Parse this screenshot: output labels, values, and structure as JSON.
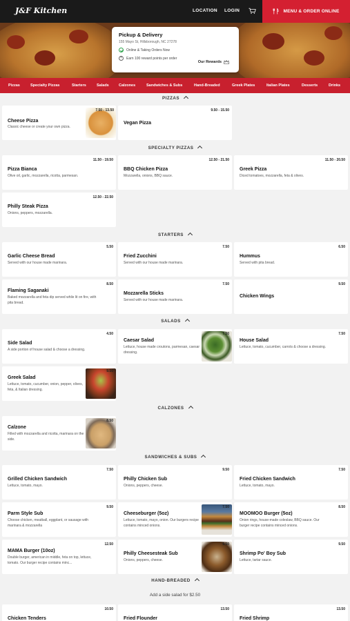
{
  "header": {
    "logo": "J&F Kitchen",
    "location_label": "LOCATION",
    "login_label": "LOGIN",
    "order_label": "MENU & ORDER ONLINE",
    "cart_icon": "cart-icon",
    "order_icon": "fork-knife-icon",
    "accent_color": "#d42031"
  },
  "pickup": {
    "title": "Pickup & Delivery",
    "address": "155 Mayo St, Hillsborough, NC 27278",
    "status": "Online & Taking Orders Now",
    "reward": "Earn 100 reward points per order",
    "rewards_link": "Our Rewards"
  },
  "categories": [
    "Pizzas",
    "Specialty Pizzas",
    "Starters",
    "Salads",
    "Calzones",
    "Sandwiches & Subs",
    "Hand-Breaded",
    "Greek Plates",
    "Italian Plates",
    "Desserts",
    "Drinks"
  ],
  "sections": {
    "pizzas": "PIZZAS",
    "specialty": "SPECIALTY PIZZAS",
    "starters": "STARTERS",
    "salads": "SALADS",
    "calzones": "CALZONES",
    "sandwiches": "SANDWICHES & SUBS",
    "handbreaded": "HAND-BREADED",
    "handbreaded_note": "Add a side salad for $2.50"
  },
  "items": {
    "cheese_pizza": {
      "name": "Cheese Pizza",
      "desc": "Classic cheese or create your own pizza.",
      "price": "7.50 - 13.50"
    },
    "vegan_pizza": {
      "name": "Vegan Pizza",
      "desc": "",
      "price": "9.50 - 15.50"
    },
    "pizza_bianca": {
      "name": "Pizza Bianca",
      "desc": "Olive oil, garlic, mozzarella, ricotta, parmesan.",
      "price": "11.50 - 19.50"
    },
    "bbq_pizza": {
      "name": "BBQ Chicken Pizza",
      "desc": "Mozzarella, onions, BBQ sauce.",
      "price": "12.50 - 21.50"
    },
    "greek_pizza": {
      "name": "Greek Pizza",
      "desc": "Diced tomatoes, mozzarella, feta & olives.",
      "price": "11.50 - 20.50"
    },
    "philly_pizza": {
      "name": "Philly Steak Pizza",
      "desc": "Onions, peppers, mozzarella.",
      "price": "12.50 - 22.50"
    },
    "garlic_bread": {
      "name": "Garlic Cheese Bread",
      "desc": "Served with our house made marinara.",
      "price": "5.50"
    },
    "fried_zucchini": {
      "name": "Fried Zucchini",
      "desc": "Served with our house made marinara.",
      "price": "7.50"
    },
    "hummus": {
      "name": "Hummus",
      "desc": "Served with pita bread.",
      "price": "6.50"
    },
    "saganaki": {
      "name": "Flaming Saganaki",
      "desc": "Baked mozzarella and feta dip served while lit on fire, with pita bread.",
      "price": "8.50"
    },
    "mozz_sticks": {
      "name": "Mozzarella Sticks",
      "desc": "Served with our house made marinara.",
      "price": "7.50"
    },
    "wings": {
      "name": "Chicken Wings",
      "desc": "",
      "price": "9.50"
    },
    "side_salad": {
      "name": "Side Salad",
      "desc": "A side portion of house salad & choose a dressing.",
      "price": "4.50"
    },
    "caesar_salad": {
      "name": "Caesar Salad",
      "desc": "Lettuce, house made croutons, parmesan, caesar dressing.",
      "price": "7.50"
    },
    "house_salad": {
      "name": "House Salad",
      "desc": "Lettuce, tomato, cucumber, carrots & choose a dressing.",
      "price": "7.50"
    },
    "greek_salad": {
      "name": "Greek Salad",
      "desc": "Lettuce, tomato, cucumber, onion, pepper, olives, feta, & Italian dressing.",
      "price": "9.50"
    },
    "calzone": {
      "name": "Calzone",
      "desc": "Filled with mozzarella and ricotta, marinara on the side.",
      "price": "8.50"
    },
    "grilled_chicken": {
      "name": "Grilled Chicken Sandwich",
      "desc": "Lettuce, tomato, mayo.",
      "price": "7.50"
    },
    "philly_chicken": {
      "name": "Philly Chicken Sub",
      "desc": "Onions, peppers, cheese.",
      "price": "9.50"
    },
    "fried_chicken_sw": {
      "name": "Fried Chicken Sandwich",
      "desc": "Lettuce, tomato, mayo.",
      "price": "7.50"
    },
    "parm_sub": {
      "name": "Parm Style Sub",
      "desc": "Choose chicken, meatball, eggplant, or sausage with marinara & mozzarella",
      "price": "9.50"
    },
    "cheeseburger": {
      "name": "Cheeseburger (5oz)",
      "desc": "Lettuce, tomato, mayo, onion. Our burgers recipe contains minced onions.",
      "price": "7.50"
    },
    "moomoo": {
      "name": "MOOMOO Burger (5oz)",
      "desc": "Onion rings, house-made coleslaw, BBQ sauce. Our burger recipe contains minced onions.",
      "price": "8.50"
    },
    "mama_burger": {
      "name": "MAMA Burger (10oz)",
      "desc": "Double burger, american in middle, feta on top, lettuce, tomato. Our burger recipe contains minc...",
      "price": "12.50"
    },
    "philly_steak_sub": {
      "name": "Philly Cheesesteak Sub",
      "desc": "Onions, peppers, cheese.",
      "price": "9.50"
    },
    "shrimp_poboy": {
      "name": "Shrimp Po' Boy Sub",
      "desc": "Lettuce, tartar sauce.",
      "price": "9.50"
    },
    "chicken_tenders": {
      "name": "Chicken Tenders",
      "desc": "",
      "price": "10.50"
    },
    "fried_flounder": {
      "name": "Fried Flounder",
      "desc": "",
      "price": "13.50"
    },
    "fried_shrimp": {
      "name": "Fried Shrimp",
      "desc": "",
      "price": "13.50"
    }
  }
}
